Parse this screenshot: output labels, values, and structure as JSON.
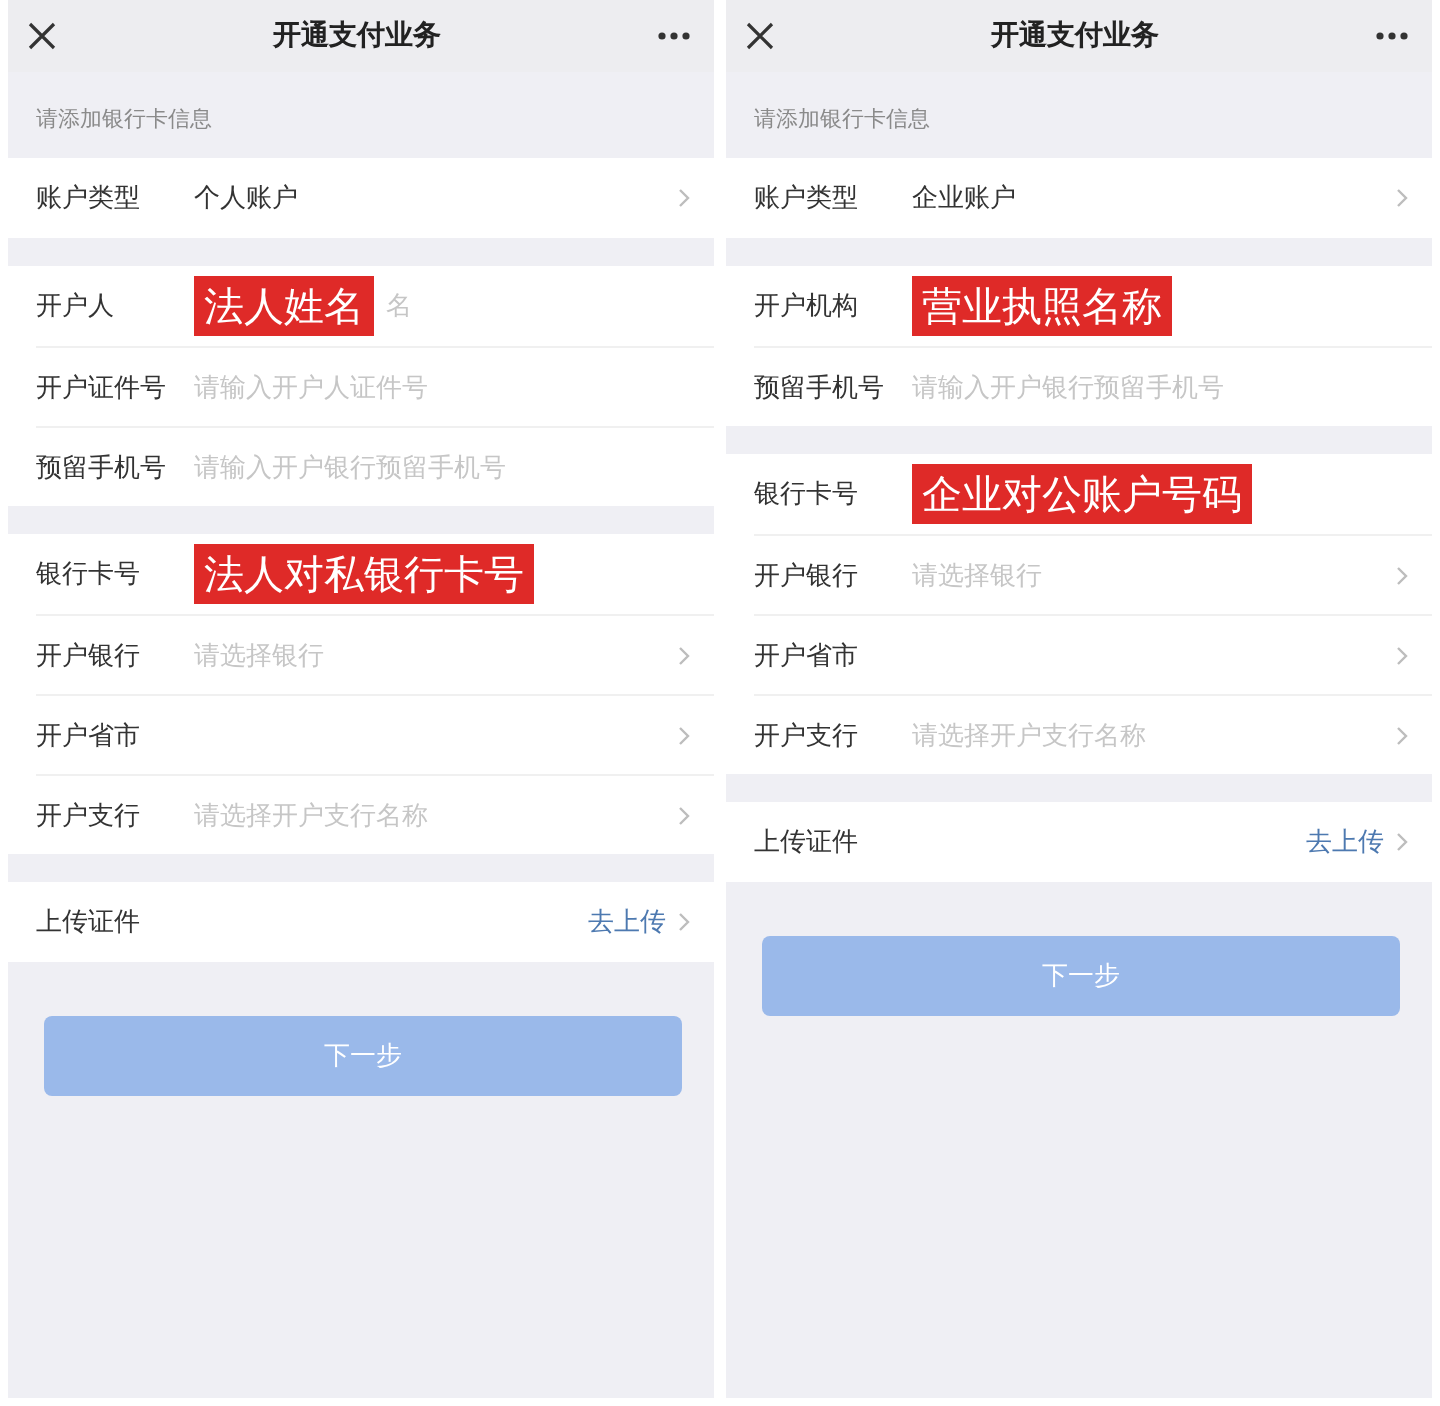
{
  "panels": [
    {
      "header": {
        "title": "开通支付业务"
      },
      "hint": "请添加银行卡信息",
      "sections": [
        {
          "rows": [
            {
              "kind": "select",
              "label": "账户类型",
              "value": "个人账户"
            }
          ]
        },
        {
          "rows": [
            {
              "kind": "input",
              "label": "开户人",
              "annotation": "法人姓名",
              "placeholder": "名"
            },
            {
              "kind": "input",
              "label": "开户证件号",
              "placeholder": "请输入开户人证件号"
            },
            {
              "kind": "input",
              "label": "预留手机号",
              "placeholder": "请输入开户银行预留手机号"
            }
          ]
        },
        {
          "rows": [
            {
              "kind": "input",
              "label": "银行卡号",
              "annotation": "法人对私银行卡号"
            },
            {
              "kind": "select",
              "label": "开户银行",
              "placeholder": "请选择银行"
            },
            {
              "kind": "select",
              "label": "开户省市"
            },
            {
              "kind": "select",
              "label": "开户支行",
              "placeholder": "请选择开户支行名称"
            }
          ]
        },
        {
          "rows": [
            {
              "kind": "link",
              "label": "上传证件",
              "link": "去上传"
            }
          ]
        }
      ],
      "button": {
        "label": "下一步",
        "disabled": true
      }
    },
    {
      "header": {
        "title": "开通支付业务"
      },
      "hint": "请添加银行卡信息",
      "sections": [
        {
          "rows": [
            {
              "kind": "select",
              "label": "账户类型",
              "value": "企业账户"
            }
          ]
        },
        {
          "rows": [
            {
              "kind": "input",
              "label": "开户机构",
              "annotation": "营业执照名称"
            },
            {
              "kind": "input",
              "label": "预留手机号",
              "placeholder": "请输入开户银行预留手机号"
            }
          ]
        },
        {
          "rows": [
            {
              "kind": "input",
              "label": "银行卡号",
              "annotation": "企业对公账户号码"
            },
            {
              "kind": "select",
              "label": "开户银行",
              "placeholder": "请选择银行"
            },
            {
              "kind": "select",
              "label": "开户省市"
            },
            {
              "kind": "select",
              "label": "开户支行",
              "placeholder": "请选择开户支行名称"
            }
          ]
        },
        {
          "rows": [
            {
              "kind": "link",
              "label": "上传证件",
              "link": "去上传"
            }
          ]
        }
      ],
      "button": {
        "label": "下一步",
        "disabled": true
      }
    }
  ]
}
